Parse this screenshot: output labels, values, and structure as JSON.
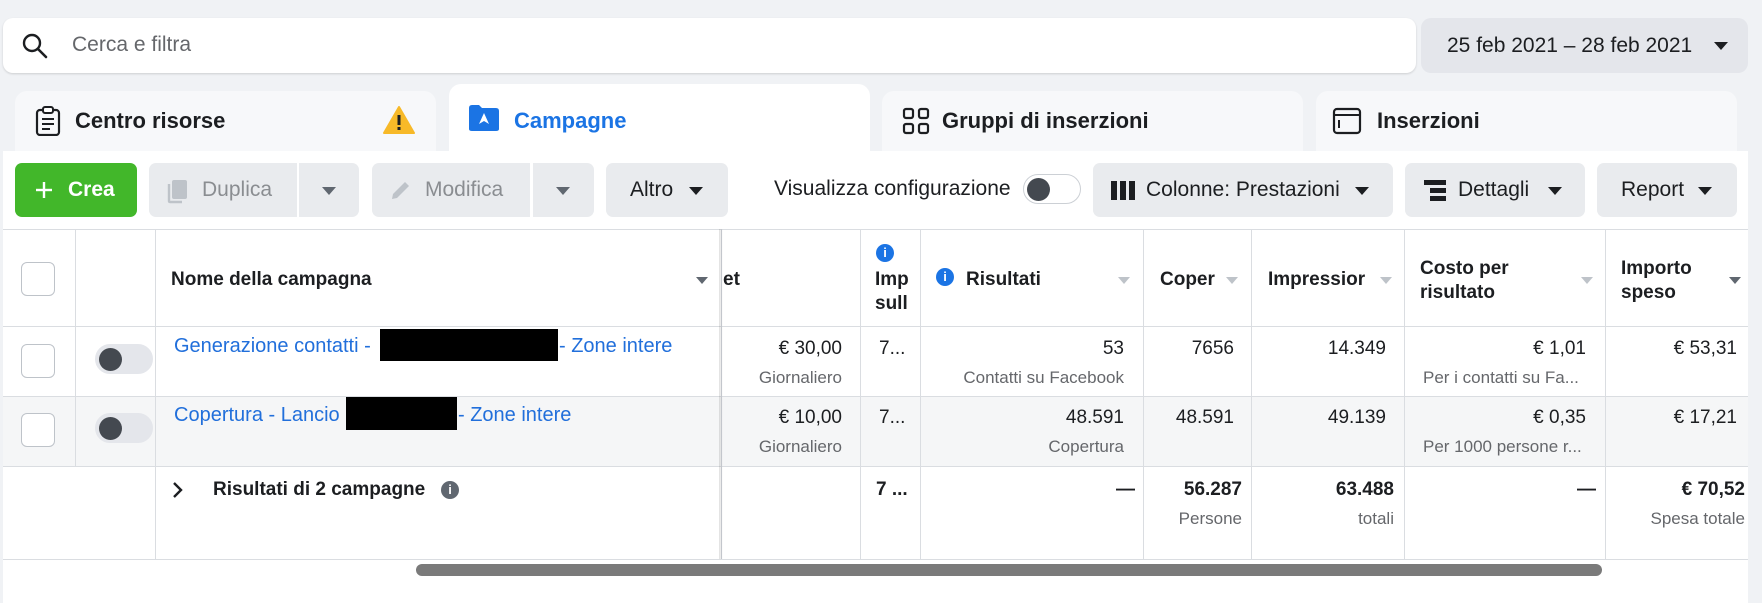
{
  "search": {
    "placeholder": "Cerca e filtra"
  },
  "date_range": {
    "label": "25 feb 2021 – 28 feb 2021"
  },
  "tabs": [
    {
      "label": "Centro risorse",
      "icon": "clipboard-icon"
    },
    {
      "label": "Campagne",
      "icon": "campaign-folder-icon"
    },
    {
      "label": "Gruppi di inserzioni",
      "icon": "grid-icon"
    },
    {
      "label": "Inserzioni",
      "icon": "ad-window-icon"
    }
  ],
  "toolbar": {
    "create": "Crea",
    "duplicate": "Duplica",
    "edit": "Modifica",
    "more": "Altro",
    "view_setup": "Visualizza configurazione",
    "columns": "Colonne: Prestazioni",
    "breakdown": "Dettagli",
    "report": "Report"
  },
  "table": {
    "headers": {
      "name": "Nome della campagna",
      "budget": "et",
      "imp_1": "Imp",
      "imp_2": "sull",
      "results": "Risultati",
      "reach": "Coper",
      "impressions": "Impressior",
      "cost_1": "Costo per",
      "cost_2": "risultato",
      "spent_1": "Importo",
      "spent_2": "speso"
    },
    "rows": [
      {
        "name_left": "Generazione contatti -",
        "name_right": "- Zone intere",
        "budget": "€ 30,00",
        "budget_sub": "Giornaliero",
        "imp": "7...",
        "results": "53",
        "results_sub": "Contatti su Facebook",
        "reach": "7656",
        "impressions": "14.349",
        "cost": "€ 1,01",
        "cost_sub": "Per i contatti su Fa...",
        "spent": "€ 53,31"
      },
      {
        "name_left": "Copertura - Lancio",
        "name_right": "- Zone intere",
        "budget": "€ 10,00",
        "budget_sub": "Giornaliero",
        "imp": "7...",
        "results": "48.591",
        "results_sub": "Copertura",
        "reach": "48.591",
        "impressions": "49.139",
        "cost": "€ 0,35",
        "cost_sub": "Per 1000 persone r...",
        "spent": "€ 17,21"
      }
    ],
    "summary": {
      "label": "Risultati di 2 campagne",
      "imp": "7 ...",
      "results": "—",
      "reach": "56.287",
      "reach_sub": "Persone",
      "impressions": "63.488",
      "impressions_sub": "totali",
      "cost": "—",
      "spent": "€ 70,52",
      "spent_sub": "Spesa totale"
    }
  },
  "colors": {
    "accent": "#1b74e4",
    "create_green": "#42b72a",
    "link": "#216fdb",
    "warning": "#f7b928"
  }
}
